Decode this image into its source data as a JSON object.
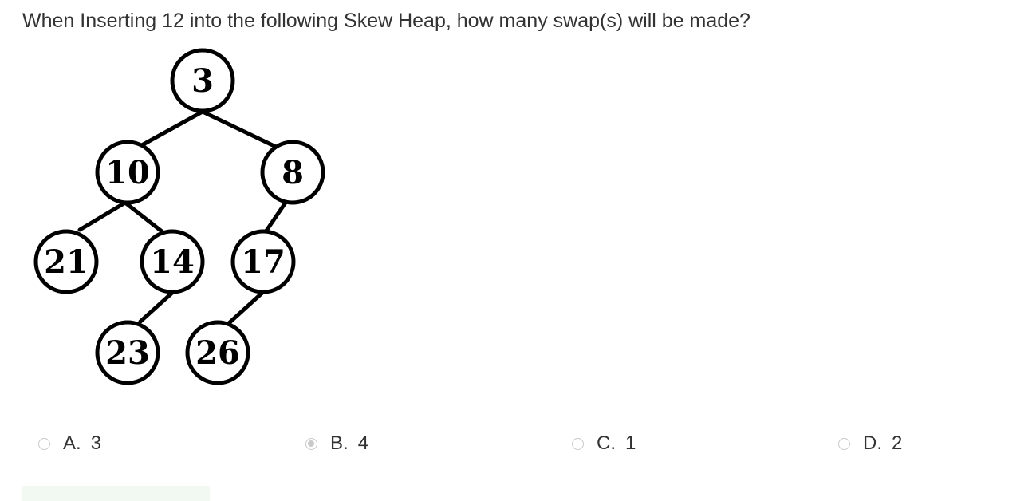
{
  "question": {
    "text": "When Inserting 12 into the following Skew Heap, how many swap(s) will be made?"
  },
  "heap": {
    "root": "3",
    "left": "10",
    "right": "8",
    "left_left": "21",
    "left_right": "14",
    "right_left": "17",
    "left_right_left": "23",
    "right_left_left": "26"
  },
  "options": [
    {
      "letter": "A.",
      "value": "3",
      "selected": false
    },
    {
      "letter": "B.",
      "value": "4",
      "selected": true
    },
    {
      "letter": "C.",
      "value": "1",
      "selected": false
    },
    {
      "letter": "D.",
      "value": "2",
      "selected": false
    }
  ],
  "colors": {
    "text": "#333333",
    "radio_border": "#c8c8c8",
    "radio_selected": "#c9c9c9",
    "feedback_bar": "#f2f9f2"
  }
}
